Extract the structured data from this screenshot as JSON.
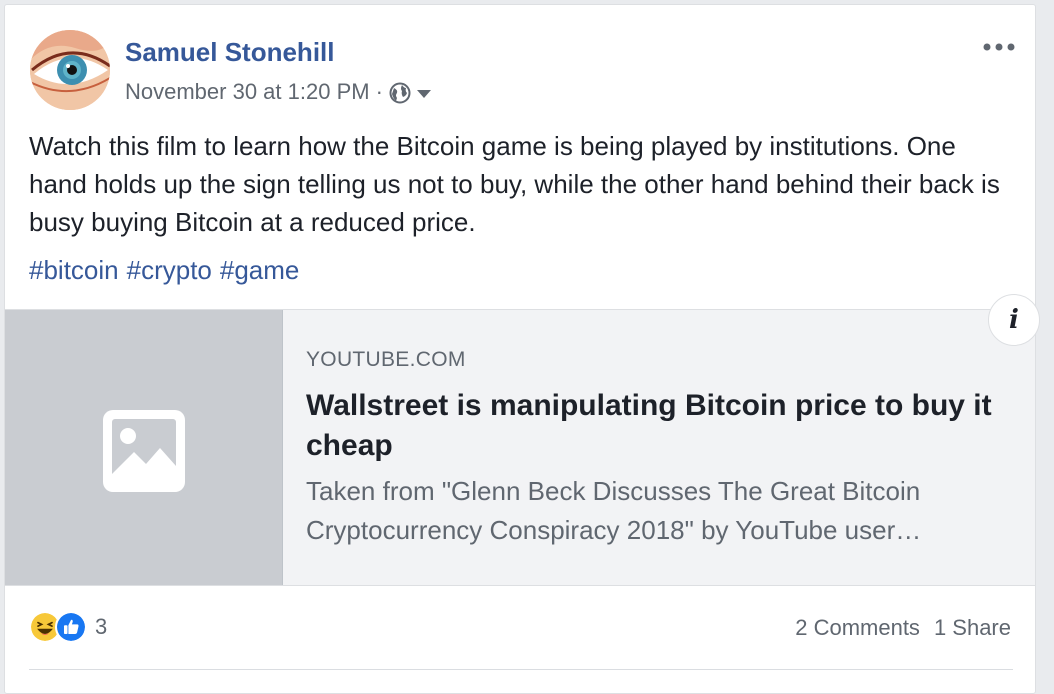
{
  "post": {
    "author": "Samuel Stonehill",
    "timestamp": "November 30 at 1:20 PM",
    "separator": "·",
    "privacy_icon": "globe-icon",
    "text": "Watch this film to learn how the Bitcoin game is being played by institutions. One hand holds up the sign telling us not to buy, while the other hand behind their back is busy buying Bitcoin at a reduced price.",
    "hashtags": [
      "#bitcoin",
      "#crypto",
      "#game"
    ]
  },
  "link_preview": {
    "domain": "YOUTUBE.COM",
    "title": "Wallstreet is manipulating Bitcoin price to buy it cheap",
    "description": "Taken from \"Glenn Beck Discusses The Great Bitcoin Cryptocurrency Conspiracy 2018\" by YouTube user…",
    "info_label": "i"
  },
  "footer": {
    "reaction_icons": [
      "haha-icon",
      "like-icon"
    ],
    "reaction_count": "3",
    "comments": "2 Comments",
    "shares": "1 Share"
  },
  "colors": {
    "link_blue": "#365899",
    "secondary_text": "#606770",
    "preview_bg": "#f2f3f5",
    "thumb_bg": "#c9ccd1",
    "like_blue": "#1877f2",
    "haha_yellow": "#f7c839"
  }
}
